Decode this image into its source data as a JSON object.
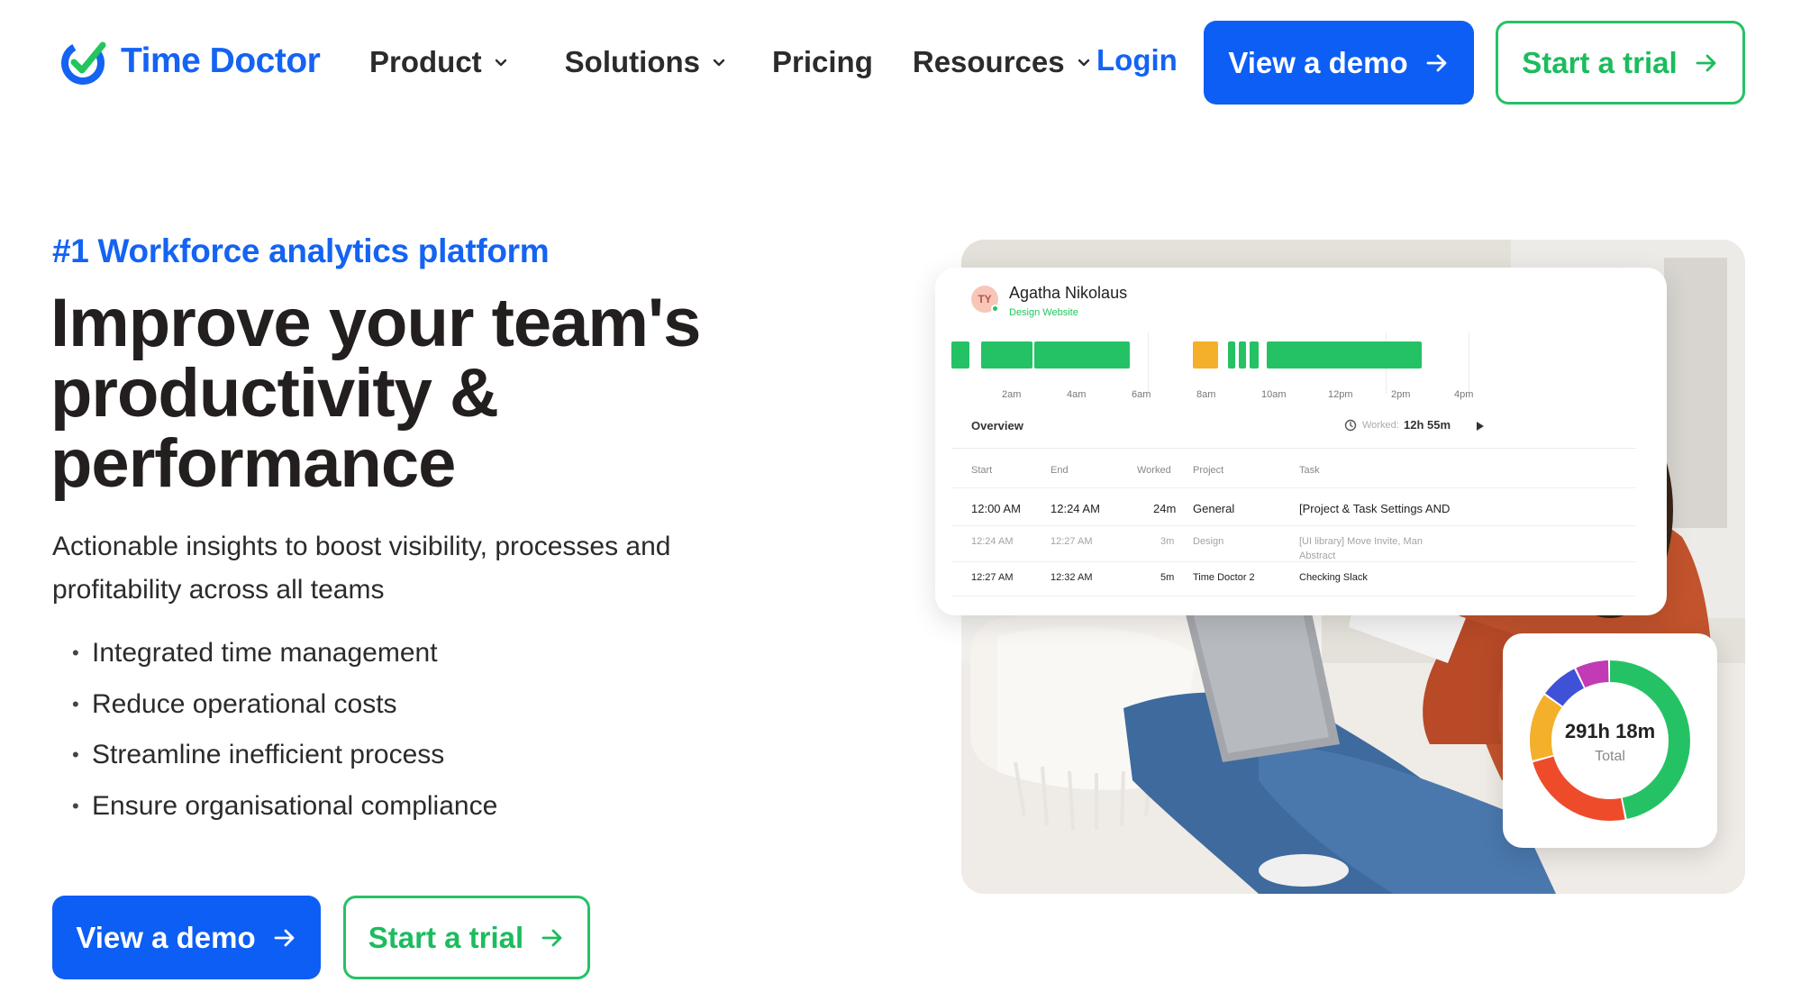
{
  "brand": {
    "name": "Time Doctor",
    "primary": "#1463f3",
    "accent_green": "#25c265"
  },
  "nav": {
    "items": [
      {
        "label": "Product",
        "has_dropdown": true
      },
      {
        "label": "Solutions",
        "has_dropdown": true
      },
      {
        "label": "Pricing",
        "has_dropdown": false
      },
      {
        "label": "Resources",
        "has_dropdown": true
      }
    ],
    "login": "Login",
    "demo_button": "View a demo",
    "trial_button": "Start a trial"
  },
  "hero": {
    "eyebrow": "#1 Workforce analytics platform",
    "headline_lines": [
      "Improve your team's",
      "productivity &",
      "performance"
    ],
    "subtext": "Actionable insights to boost visibility, processes and profitability across all teams",
    "bullets": [
      "Integrated time management",
      "Reduce operational costs",
      "Streamline inefficient process",
      "Ensure organisational compliance"
    ],
    "demo_button": "View a demo",
    "trial_button": "Start a trial"
  },
  "dashboard": {
    "user_initials": "TY",
    "user_name": "Agatha Nikolaus",
    "user_project": "Design Website",
    "time_ticks": [
      "2am",
      "4am",
      "6am",
      "8am",
      "10am",
      "12pm",
      "2pm",
      "4pm"
    ],
    "overview_label": "Overview",
    "worked_label": "Worked:",
    "worked_value": "12h 55m",
    "columns": [
      "Start",
      "End",
      "Worked",
      "Project",
      "Task"
    ],
    "rows": [
      {
        "start": "12:00 AM",
        "end": "12:24 AM",
        "worked": "24m",
        "project": "General",
        "task": "[Project & Task Settings AND",
        "dim": false
      },
      {
        "start": "12:24 AM",
        "end": "12:27 AM",
        "worked": "3m",
        "project": "Design",
        "task": "[UI library] Move Invite, Man",
        "task_cont": "Abstract",
        "dim": true
      },
      {
        "start": "12:27 AM",
        "end": "12:32 AM",
        "worked": "5m",
        "project": "Time Doctor 2",
        "task": "Checking Slack",
        "dim": false
      }
    ],
    "colors": {
      "productive": "#25c265",
      "idle": "#f4b02a"
    }
  },
  "donut": {
    "value": "291h 18m",
    "label": "Total",
    "segments": [
      {
        "color": "#25c265",
        "fraction": 0.47
      },
      {
        "color": "#ee4b2b",
        "fraction": 0.24
      },
      {
        "color": "#f4b02a",
        "fraction": 0.14
      },
      {
        "color": "#3f51d6",
        "fraction": 0.08
      },
      {
        "color": "#c33ab5",
        "fraction": 0.07
      }
    ]
  }
}
